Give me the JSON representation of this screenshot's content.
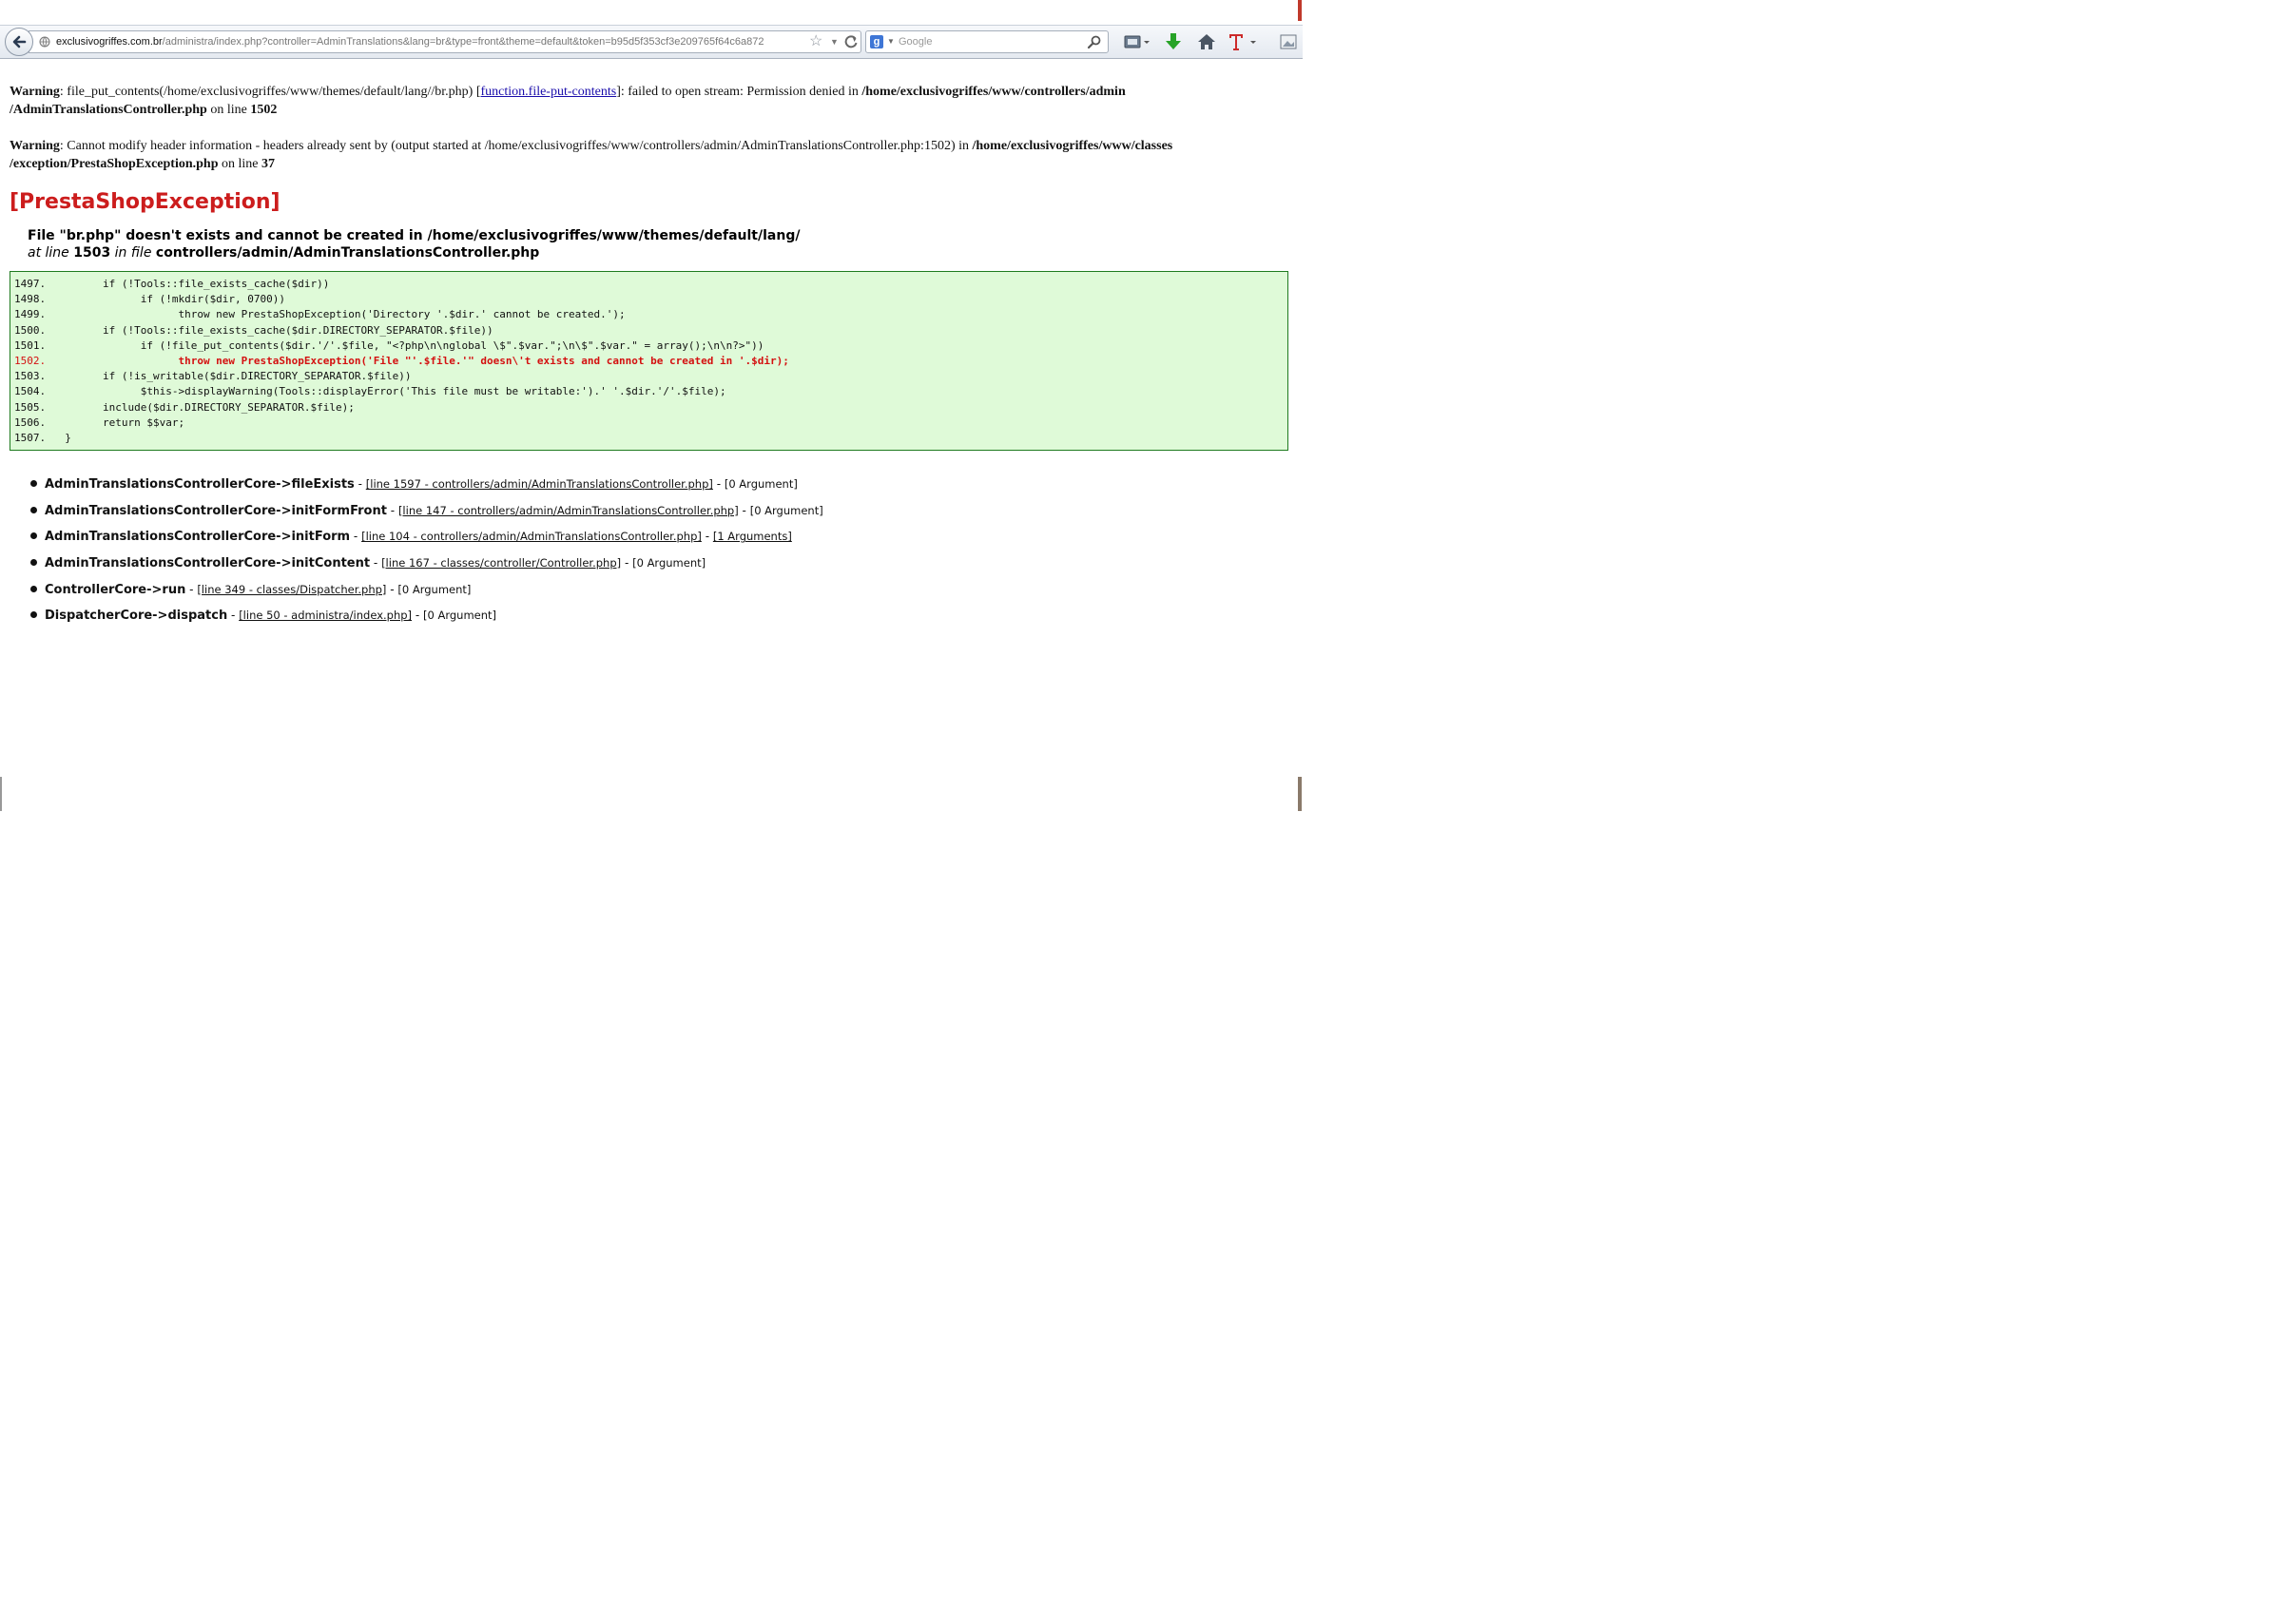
{
  "browser": {
    "url_domain": "exclusivogriffes.com.br",
    "url_path": "/administra/index.php?controller=AdminTranslations&lang=br&type=front&theme=default&token=b95d5f353cf3e209765f64c6a872",
    "search_placeholder": "Google",
    "toolbar_icons": [
      "back-icon",
      "globe-icon",
      "star-icon",
      "reload-icon",
      "search-engine-icon",
      "magnifier-icon",
      "bookmarks-icon",
      "download-icon",
      "home-icon",
      "text-tool-icon",
      "screenshot-icon"
    ],
    "accent_colors": {
      "download": "#27a327",
      "text_tool": "#cc2b2b"
    }
  },
  "warnings": [
    {
      "label": "Warning",
      "pre": ": file_put_contents(/home/exclusivogriffes/www/themes/default/lang//br.php) [",
      "link": "function.file-put-contents",
      "mid": "]: failed to open stream: Permission denied in ",
      "file": "/home/exclusivogriffes/www/controllers/admin /AdminTranslationsController.php",
      "online": " on line ",
      "line": "1502"
    },
    {
      "label": "Warning",
      "pre": ": Cannot modify header information - headers already sent by (output started at /home/exclusivogriffes/www/controllers/admin/AdminTranslationsController.php:1502) in ",
      "file": "/home/exclusivogriffes/www/classes /exception/PrestaShopException.php",
      "online": " on line ",
      "line": "37"
    }
  ],
  "exception": {
    "title": "[PrestaShopException]",
    "message": "File \"br.php\" doesn't exists and cannot be created in /home/exclusivogriffes/www/themes/default/lang/",
    "at_line_label": "at line",
    "line": "1503",
    "in_file_label": "in file",
    "file": "controllers/admin/AdminTranslationsController.php",
    "error_color": "#cc1d1d"
  },
  "code": [
    {
      "num": "1497.",
      "text": "        if (!Tools::file_exists_cache($dir))"
    },
    {
      "num": "1498.",
      "text": "              if (!mkdir($dir, 0700))"
    },
    {
      "num": "1499.",
      "text": "                    throw new PrestaShopException('Directory '.$dir.' cannot be created.');"
    },
    {
      "num": "1500.",
      "text": "        if (!Tools::file_exists_cache($dir.DIRECTORY_SEPARATOR.$file))"
    },
    {
      "num": "1501.",
      "text": "              if (!file_put_contents($dir.'/'.$file, \"<?php\\n\\nglobal \\$\".$var.\";\\n\\$\".$var.\" = array();\\n\\n?>\"))"
    },
    {
      "num": "1502.",
      "text": "                    throw new PrestaShopException('File \"'.$file.'\" doesn\\'t exists and cannot be created in '.$dir);",
      "error": true
    },
    {
      "num": "1503.",
      "text": "        if (!is_writable($dir.DIRECTORY_SEPARATOR.$file))"
    },
    {
      "num": "1504.",
      "text": "              $this->displayWarning(Tools::displayError('This file must be writable:').' '.$dir.'/'.$file);"
    },
    {
      "num": "1505.",
      "text": "        include($dir.DIRECTORY_SEPARATOR.$file);"
    },
    {
      "num": "1506.",
      "text": "        return $$var;"
    },
    {
      "num": "1507.",
      "text": "  }"
    }
  ],
  "trace": [
    {
      "fn": "AdminTranslationsControllerCore->fileExists",
      "loc": "[line 1597 - controllers/admin/AdminTranslationsController.php]",
      "args": "[0 Argument]",
      "args_link": false
    },
    {
      "fn": "AdminTranslationsControllerCore->initFormFront",
      "loc": "[line 147 - controllers/admin/AdminTranslationsController.php]",
      "args": "[0 Argument]",
      "args_link": false
    },
    {
      "fn": "AdminTranslationsControllerCore->initForm",
      "loc": "[line 104 - controllers/admin/AdminTranslationsController.php]",
      "args": "[1 Arguments]",
      "args_link": true
    },
    {
      "fn": "AdminTranslationsControllerCore->initContent",
      "loc": "[line 167 - classes/controller/Controller.php]",
      "args": "[0 Argument]",
      "args_link": false
    },
    {
      "fn": "ControllerCore->run",
      "loc": "[line 349 - classes/Dispatcher.php]",
      "args": "[0 Argument]",
      "args_link": false
    },
    {
      "fn": "DispatcherCore->dispatch",
      "loc": "[line 50 - administra/index.php]",
      "args": "[0 Argument]",
      "args_link": false
    }
  ],
  "separator": " - "
}
